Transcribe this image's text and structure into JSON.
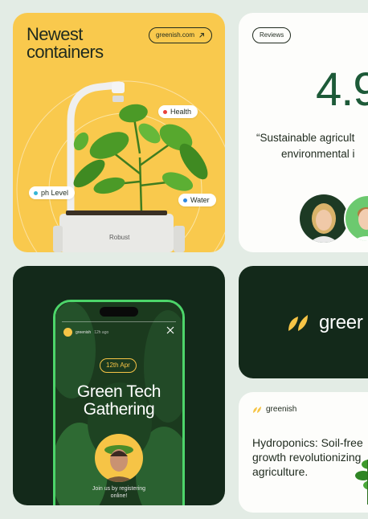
{
  "product_card": {
    "title_line1": "Newest",
    "title_line2": "containers",
    "link_label": "greenish.com",
    "pills": [
      {
        "label": "Health",
        "dot_color": "#e8413a"
      },
      {
        "label": "ph Level",
        "dot_color": "#35b6d6"
      },
      {
        "label": "Water",
        "dot_color": "#2f88e0"
      }
    ],
    "planter_label": "Robust"
  },
  "reviews_card": {
    "tag": "Reviews",
    "score": "4.9",
    "quote_line1": "“Sustainable agricult",
    "quote_line2": "environmental i"
  },
  "event_card": {
    "phone_header": {
      "brand": "greenish",
      "time": "12h ago"
    },
    "date_badge": "12th Apr",
    "title_line1": "Green Tech",
    "title_line2": "Gathering",
    "footer_line1": "Join us by registering",
    "footer_line2": "online!"
  },
  "brand_card": {
    "name": "greer"
  },
  "article_card": {
    "brand": "greenish",
    "title": "Hydroponics: Soil-free growth revolutionizing agriculture."
  },
  "colors": {
    "background": "#e3ece5",
    "yellow": "#f9c94d",
    "dark_green": "#13291a",
    "accent_green": "#4dd56a",
    "score_green": "#1d5a38"
  },
  "icons": [
    "arrow-up-right-icon",
    "close-icon",
    "greenish-leaf-logo-icon"
  ]
}
